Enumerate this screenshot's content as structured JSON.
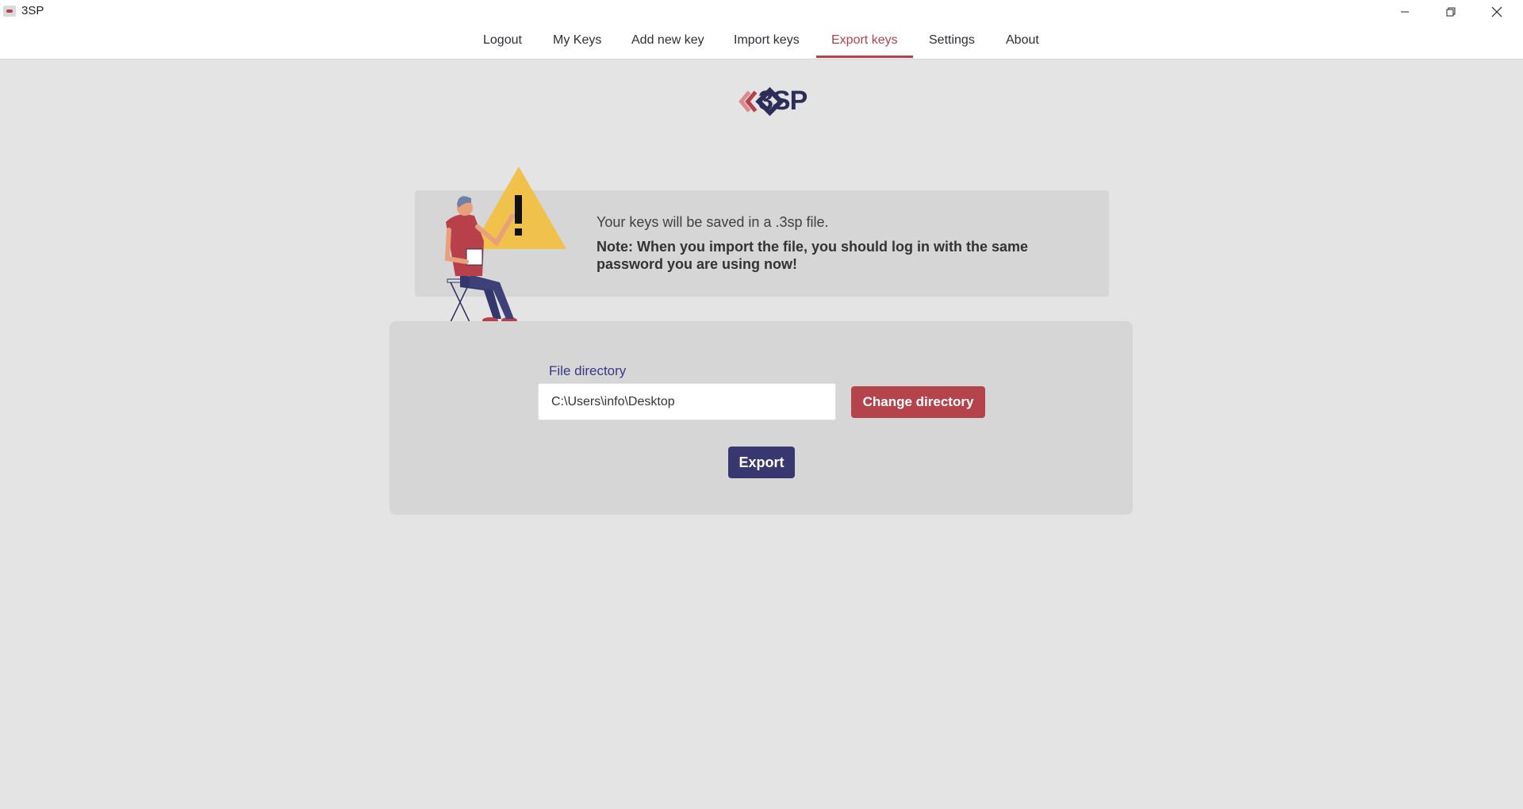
{
  "window": {
    "title": "3SP",
    "controls": [
      "minimize-icon",
      "restore-icon",
      "close-icon"
    ]
  },
  "nav": {
    "items": [
      {
        "label": "Logout"
      },
      {
        "label": "My Keys"
      },
      {
        "label": "Add new key"
      },
      {
        "label": "Import keys"
      },
      {
        "label": "Export keys",
        "active": true
      },
      {
        "label": "Settings"
      },
      {
        "label": "About"
      }
    ]
  },
  "logo": {
    "text": "3SP"
  },
  "notice": {
    "line1": "Your keys will be saved in a .3sp file.",
    "line2": "Note: When you import the file, you should log in with the same password you are using now!"
  },
  "export_form": {
    "field_label": "File directory",
    "directory_value": "C:\\Users\\info\\Desktop",
    "change_button": "Change directory",
    "export_button": "Export"
  },
  "colors": {
    "accent_red": "#b7404a",
    "primary_navy": "#38376f",
    "warning_yellow": "#f0c14b"
  }
}
